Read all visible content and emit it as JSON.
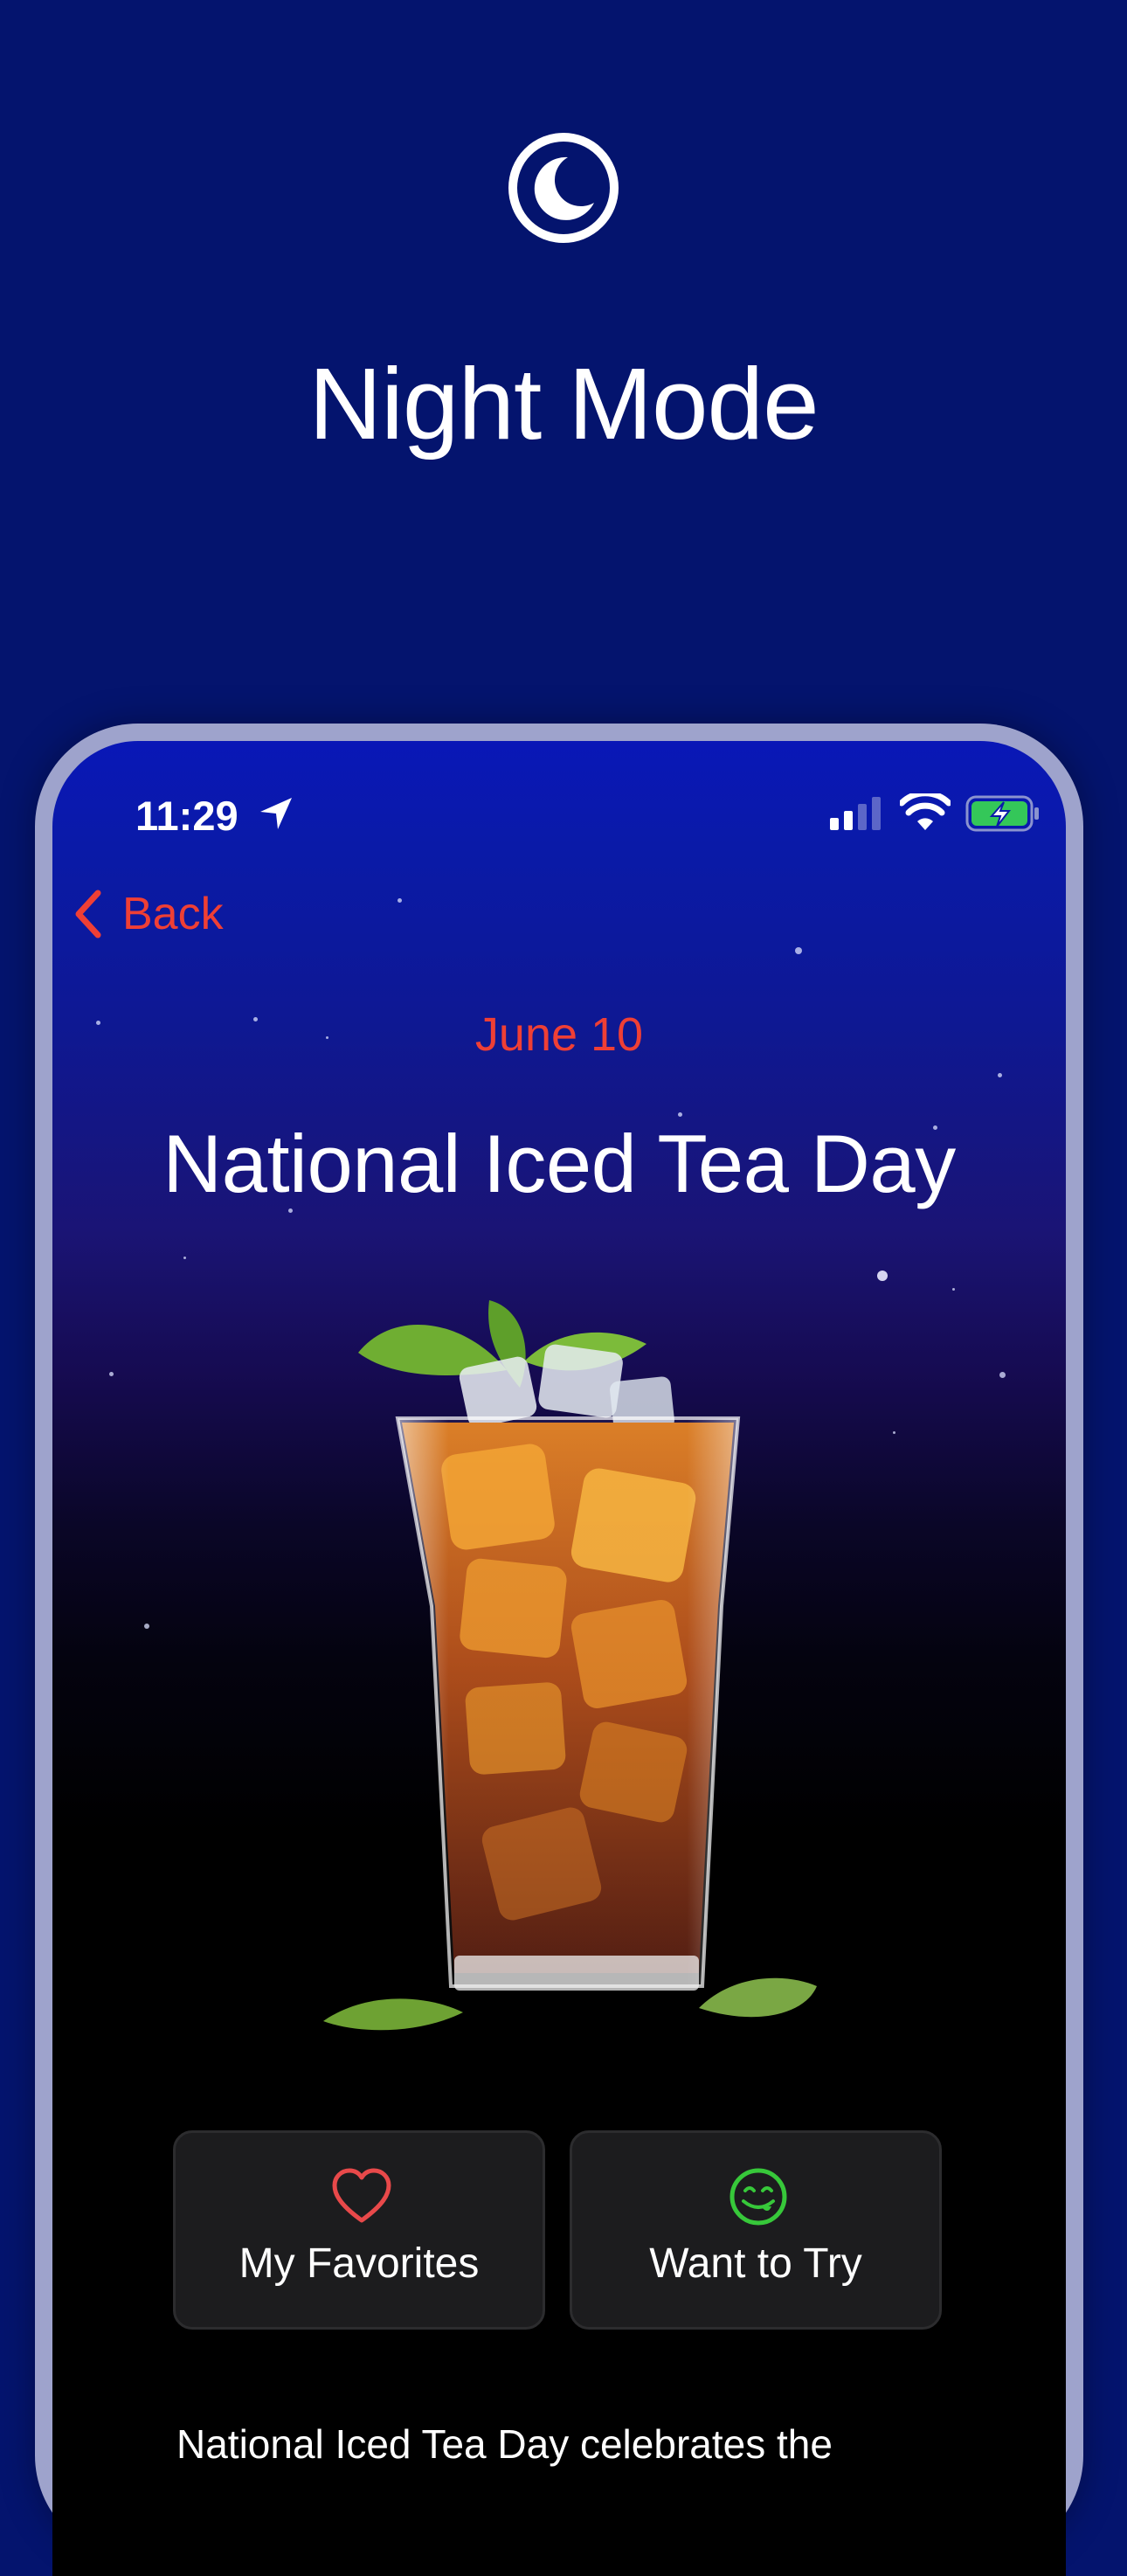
{
  "promo": {
    "headline": "Night Mode",
    "icon": "moon-icon"
  },
  "status_bar": {
    "time": "11:29",
    "icons": [
      "location-arrow-icon",
      "signal-icon",
      "wifi-icon",
      "battery-charging-icon"
    ]
  },
  "nav": {
    "back_label": "Back"
  },
  "detail": {
    "date": "June 10",
    "title": "National Iced Tea Day",
    "image": "iced-tea-glass",
    "description": "National Iced Tea Day celebrates the"
  },
  "actions": {
    "favorites_label": "My Favorites",
    "favorites_icon": "heart-icon",
    "try_label": "Want to Try",
    "try_icon": "yum-face-icon"
  },
  "colors": {
    "background": "#04146e",
    "accent_red": "#ef3f35",
    "heart": "#e8494a",
    "yum_green": "#37c83a",
    "battery_green": "#34c759"
  }
}
